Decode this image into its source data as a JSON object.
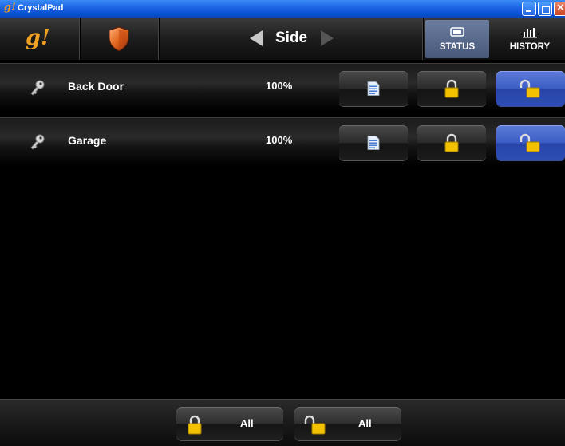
{
  "window": {
    "title": "CrystalPad",
    "icon": "g!"
  },
  "navbar": {
    "logo_text": "g!",
    "zone_name": "Side",
    "tabs": [
      {
        "label": "STATUS",
        "icon": "status-icon",
        "active": true
      },
      {
        "label": "HISTORY",
        "icon": "history-chart-icon",
        "active": false
      }
    ]
  },
  "locks": [
    {
      "name": "Back Door",
      "battery": "100%",
      "state": "unlocked"
    },
    {
      "name": "Garage",
      "battery": "100%",
      "state": "unlocked"
    }
  ],
  "footer": {
    "lock_all_label": "All",
    "unlock_all_label": "All"
  },
  "colors": {
    "accent_blue": "#3b5cc4",
    "lock_yellow": "#f2c200",
    "logo_orange": "#f0a020",
    "shield_orange": "#e2661e"
  }
}
